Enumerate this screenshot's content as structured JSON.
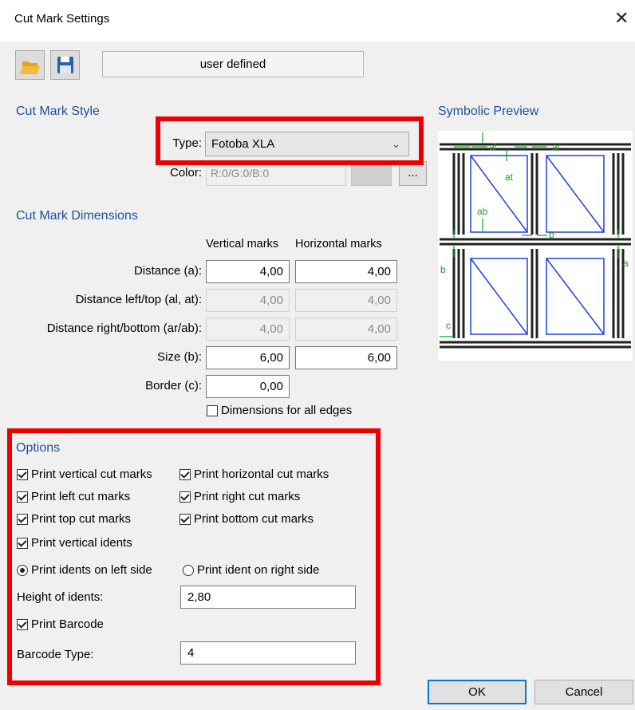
{
  "window": {
    "title": "Cut Mark Settings",
    "close_glyph": "✕"
  },
  "toolbar": {
    "open_icon": "folder-open-icon",
    "save_icon": "floppy-disk-icon",
    "preset": "user defined"
  },
  "style_section": {
    "heading": "Cut Mark Style",
    "type_label": "Type:",
    "type_value": "Fotoba XLA",
    "color_label": "Color:",
    "color_value": "R:0/G:0/B:0",
    "color_button": "..."
  },
  "dimensions": {
    "heading": "Cut Mark Dimensions",
    "col_vertical": "Vertical marks",
    "col_horizontal": "Horizontal marks",
    "rows": [
      {
        "label": "Distance (a):",
        "vertical": "4,00",
        "horizontal": "4,00",
        "enabled": true
      },
      {
        "label": "Distance left/top (al, at):",
        "vertical": "4,00",
        "horizontal": "4,00",
        "enabled": false
      },
      {
        "label": "Distance right/bottom (ar/ab):",
        "vertical": "4,00",
        "horizontal": "4,00",
        "enabled": false
      },
      {
        "label": "Size (b):",
        "vertical": "6,00",
        "horizontal": "6,00",
        "enabled": true
      }
    ],
    "border_label": "Border (c):",
    "border_value": "0,00",
    "all_edges_label": "Dimensions for all edges",
    "all_edges_checked": false
  },
  "preview": {
    "heading": "Symbolic Preview",
    "labels": {
      "al": "al",
      "ar": "ar",
      "at": "at",
      "ab": "ab",
      "b_top": "b",
      "b_left": "b",
      "a": "a",
      "c": "c"
    }
  },
  "options": {
    "heading": "Options",
    "print_vertical": "Print vertical cut marks",
    "print_horizontal": "Print horizontal cut marks",
    "print_left": "Print left cut marks",
    "print_right": "Print right cut marks",
    "print_top": "Print top cut marks",
    "print_bottom": "Print bottom cut marks",
    "print_idents": "Print vertical idents",
    "idents_left": "Print idents on left side",
    "idents_right": "Print ident on right side",
    "height_label": "Height of idents:",
    "height_value": "2,80",
    "print_barcode": "Print Barcode",
    "barcode_type_label": "Barcode Type:",
    "barcode_type_value": "4"
  },
  "buttons": {
    "ok": "OK",
    "cancel": "Cancel"
  },
  "colors": {
    "highlight": "#ee0000",
    "section": "#1f4f9c",
    "preview_green": "#18a018",
    "preview_blue": "#2040e0"
  }
}
